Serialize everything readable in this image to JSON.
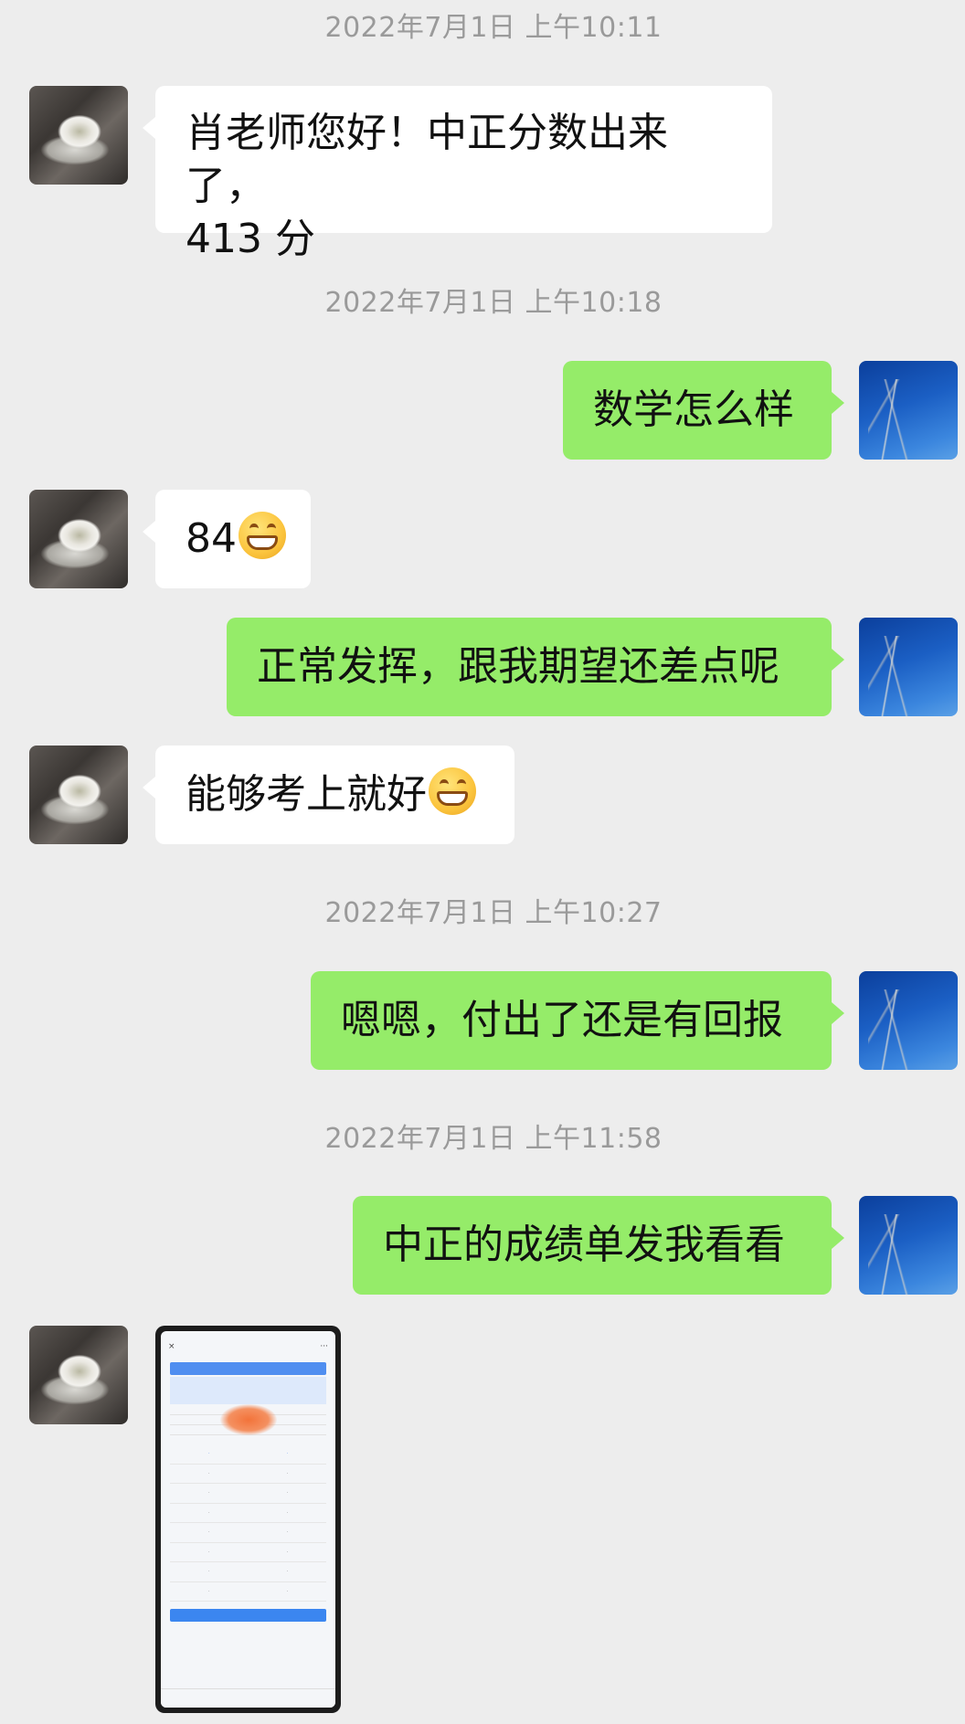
{
  "timestamps": [
    "2022年7月1日 上午10:11",
    "2022年7月1日 上午10:18",
    "2022年7月1日 上午10:27",
    "2022年7月1日 上午11:58"
  ],
  "messages": {
    "m1": "肖老师您好！中正分数出来了，",
    "m1b": "413 分",
    "m2": "数学怎么样",
    "m3": "84",
    "m4": "正常发挥，跟我期望还差点呢",
    "m5": "能够考上就好",
    "m6": "嗯嗯，付出了还是有回报",
    "m7": "中正的成绩单发我看看"
  },
  "emoji": {
    "name": "grin-emoji"
  },
  "avatars": {
    "contact": "teacup-photo",
    "self": "blue-sky-tree-photo"
  },
  "image_message": {
    "kind": "screenshot-of-score-report"
  }
}
